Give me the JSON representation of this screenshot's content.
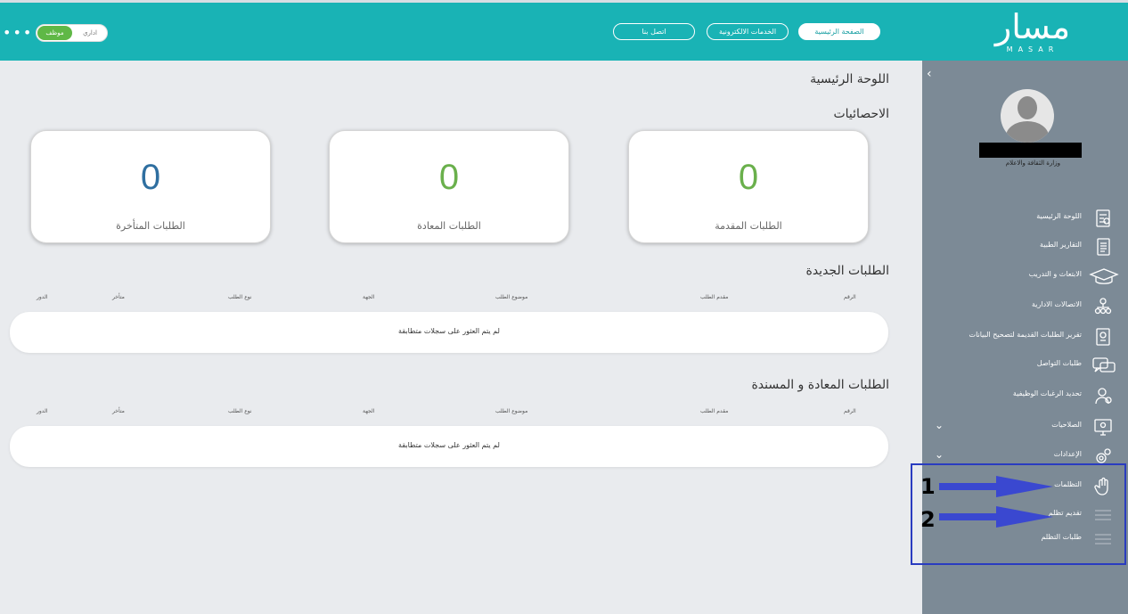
{
  "header": {
    "logo_ar": "مسار",
    "logo_en": "MASAR",
    "nav": {
      "home": "الصفحة الرئيسية",
      "eservices": "الخدمات الالكترونية",
      "contact": "اتصل بنا"
    },
    "role_toggle": {
      "admin": "اداري",
      "employee": "موظف"
    },
    "more": "•••"
  },
  "sidebar": {
    "collapse": "‹",
    "org": "وزارة الثقافة والاعلام",
    "items": [
      {
        "label": "اللوحة الرئيسية",
        "icon": "dashboard-icon"
      },
      {
        "label": "التقارير الطبية",
        "icon": "medical-report-icon"
      },
      {
        "label": "الابتعاث و التدريب",
        "icon": "graduation-cap-icon"
      },
      {
        "label": "الاتصالات الادارية",
        "icon": "org-chart-icon"
      },
      {
        "label": "تقرير الطلبات القديمة لتصحيح البيانات",
        "icon": "document-check-icon"
      },
      {
        "label": "طلبات التواصل",
        "icon": "chat-icon"
      },
      {
        "label": "تحديد الرغبات الوظيفية",
        "icon": "user-preferences-icon"
      },
      {
        "label": "الصلاحيات",
        "icon": "permissions-icon"
      },
      {
        "label": "الإعدادات",
        "icon": "settings-icon"
      },
      {
        "label": "التظلمات",
        "icon": "hand-icon"
      },
      {
        "label": "تقديم تظلم",
        "icon": "list-icon"
      },
      {
        "label": "طلبات التظلم",
        "icon": "list-icon"
      }
    ]
  },
  "annotations": {
    "num1": "1",
    "num2": "2"
  },
  "main": {
    "title": "اللوحة الرئيسية",
    "stats_title": "الاحصائيات",
    "stats": [
      {
        "value": "0",
        "label": "الطلبات المقدمة",
        "color": "#6ab04c"
      },
      {
        "value": "0",
        "label": "الطلبات المعادة",
        "color": "#6ab04c"
      },
      {
        "value": "0",
        "label": "الطلبات المتأخرة",
        "color": "#2f6fa0"
      }
    ],
    "new_requests": {
      "title": "الطلبات الجديدة",
      "columns": [
        "الرقم",
        "مقدم الطلب",
        "موضوع الطلب",
        "الجهة",
        "نوع الطلب",
        "متأخر",
        "الدور"
      ],
      "empty": "لم يتم العثور على سجلات متطابقة"
    },
    "returned_requests": {
      "title": "الطلبات المعادة و المسندة",
      "columns": [
        "الرقم",
        "مقدم الطلب",
        "موضوع الطلب",
        "الجهة",
        "نوع الطلب",
        "متأخر",
        "الدور"
      ],
      "empty": "لم يتم العثور على سجلات متطابقة"
    }
  }
}
